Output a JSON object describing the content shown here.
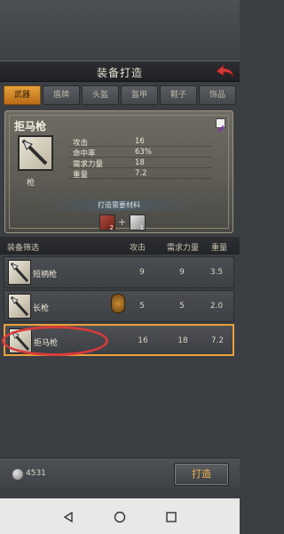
{
  "header": {
    "title": "装备打造"
  },
  "tabs": [
    "武器",
    "盾牌",
    "头盔",
    "盔甲",
    "鞋子",
    "饰品"
  ],
  "detail": {
    "item_name": "拒马枪",
    "item_type": "枪",
    "stats": [
      {
        "label": "攻击",
        "value": "16"
      },
      {
        "label": "命中率",
        "value": "63%"
      },
      {
        "label": "需求力量",
        "value": "18"
      },
      {
        "label": "重量",
        "value": "7.2"
      }
    ],
    "materials_label": "打造需要材料",
    "materials": [
      {
        "icon": "red-material",
        "count": "2"
      },
      {
        "icon": "silver-material",
        "count": "1"
      }
    ]
  },
  "filter": {
    "label": "装备筛选",
    "columns": [
      "攻击",
      "需求力量",
      "重量"
    ]
  },
  "rows": [
    {
      "name": "短柄枪",
      "attack": "9",
      "strength": "9",
      "weight": "3.5"
    },
    {
      "name": "长枪",
      "attack": "5",
      "strength": "5",
      "weight": "2.0"
    },
    {
      "name": "拒马枪",
      "attack": "16",
      "strength": "18",
      "weight": "7.2",
      "selected": true
    }
  ],
  "footer": {
    "currency": "4531",
    "forge_button": "打造"
  },
  "colors": {
    "accent": "#e8a13a",
    "annotation": "#d63b3b"
  }
}
